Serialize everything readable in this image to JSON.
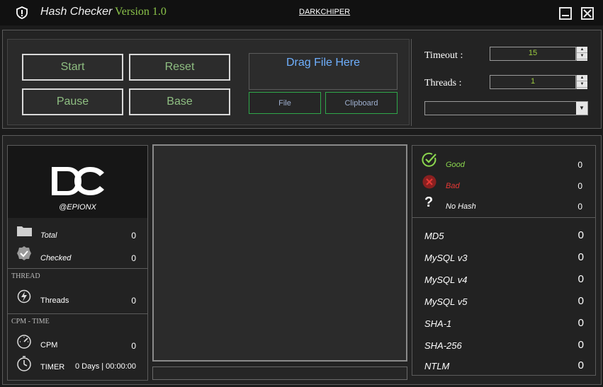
{
  "app": {
    "title": "Hash Checker",
    "version": "Version 1.0",
    "brand_link": "DARKCHIPER"
  },
  "controls": {
    "start_label": "Start",
    "reset_label": "Reset",
    "pause_label": "Pause",
    "base_label": "Base",
    "drop_label": "Drag File Here",
    "file_label": "File",
    "clipboard_label": "Clipboard"
  },
  "settings": {
    "timeout_label": "Timeout :",
    "timeout_value": "15",
    "threads_label": "Threads :",
    "threads_value": "1",
    "dropdown_value": ""
  },
  "profile": {
    "logo_text": "DC",
    "handle": "@EPIONX"
  },
  "stats": {
    "total_label": "Total",
    "total_value": "0",
    "checked_label": "Checked",
    "checked_value": "0",
    "thread_section": "THREAD",
    "threads_label": "Threads",
    "threads_value": "0",
    "cpm_section": "CPM - TIME",
    "cpm_label": "CPM",
    "cpm_value": "0",
    "timer_label": "TIMER",
    "timer_value": "0 Days | 00:00:00"
  },
  "results": {
    "good_label": "Good",
    "good_value": "0",
    "bad_label": "Bad",
    "bad_value": "0",
    "nohash_label": "No Hash",
    "nohash_value": "0"
  },
  "hashes": [
    {
      "name": "MD5",
      "value": "0"
    },
    {
      "name": "MySQL v3",
      "value": "0"
    },
    {
      "name": "MySQL v4",
      "value": "0"
    },
    {
      "name": "MySQL v5",
      "value": "0"
    },
    {
      "name": "SHA-1",
      "value": "0"
    },
    {
      "name": "SHA-256",
      "value": "0"
    },
    {
      "name": "NTLM",
      "value": "0"
    }
  ],
  "colors": {
    "good": "#8bd64e",
    "bad": "#e53935",
    "accent_green": "#2fa84a",
    "version": "#8bc34a"
  }
}
